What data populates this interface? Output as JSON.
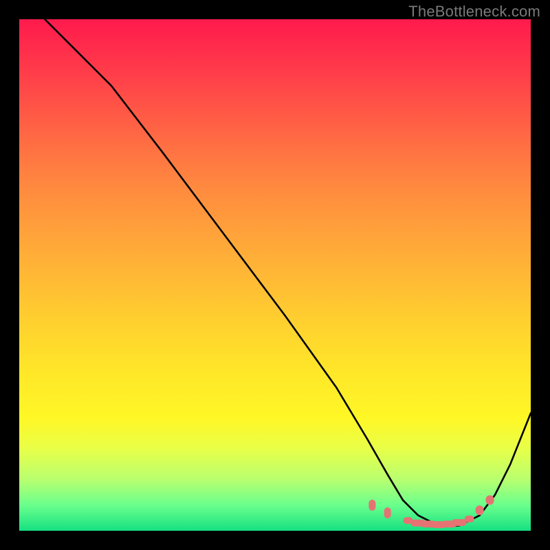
{
  "watermark": "TheBottleneck.com",
  "chart_data": {
    "type": "line",
    "title": "",
    "xlabel": "",
    "ylabel": "",
    "xlim": [
      0,
      100
    ],
    "ylim": [
      0,
      100
    ],
    "grid": false,
    "legend": false,
    "background": {
      "gradient_top_color": "#ff1a4d",
      "gradient_mid_color": "#ffe928",
      "gradient_bottom_color": "#16e082",
      "description": "vertical heat gradient red→yellow→green"
    },
    "series": [
      {
        "name": "bottleneck-curve",
        "color": "#000000",
        "x": [
          5,
          8,
          12,
          18,
          28,
          40,
          52,
          62,
          68,
          72,
          75,
          78,
          82,
          86,
          90,
          93,
          96,
          100
        ],
        "y": [
          100,
          97,
          93,
          87,
          74,
          58,
          42,
          28,
          18,
          11,
          6,
          3,
          1,
          1,
          3,
          7,
          13,
          23
        ]
      }
    ],
    "markers": [
      {
        "name": "highlight-dots",
        "shape": "rounded",
        "color": "#e57373",
        "x": [
          69,
          72,
          76,
          78,
          80,
          82,
          84,
          86,
          88,
          90,
          92
        ],
        "y": [
          5,
          3.5,
          2,
          1.5,
          1.3,
          1.2,
          1.3,
          1.6,
          2.3,
          4,
          6
        ]
      }
    ]
  }
}
